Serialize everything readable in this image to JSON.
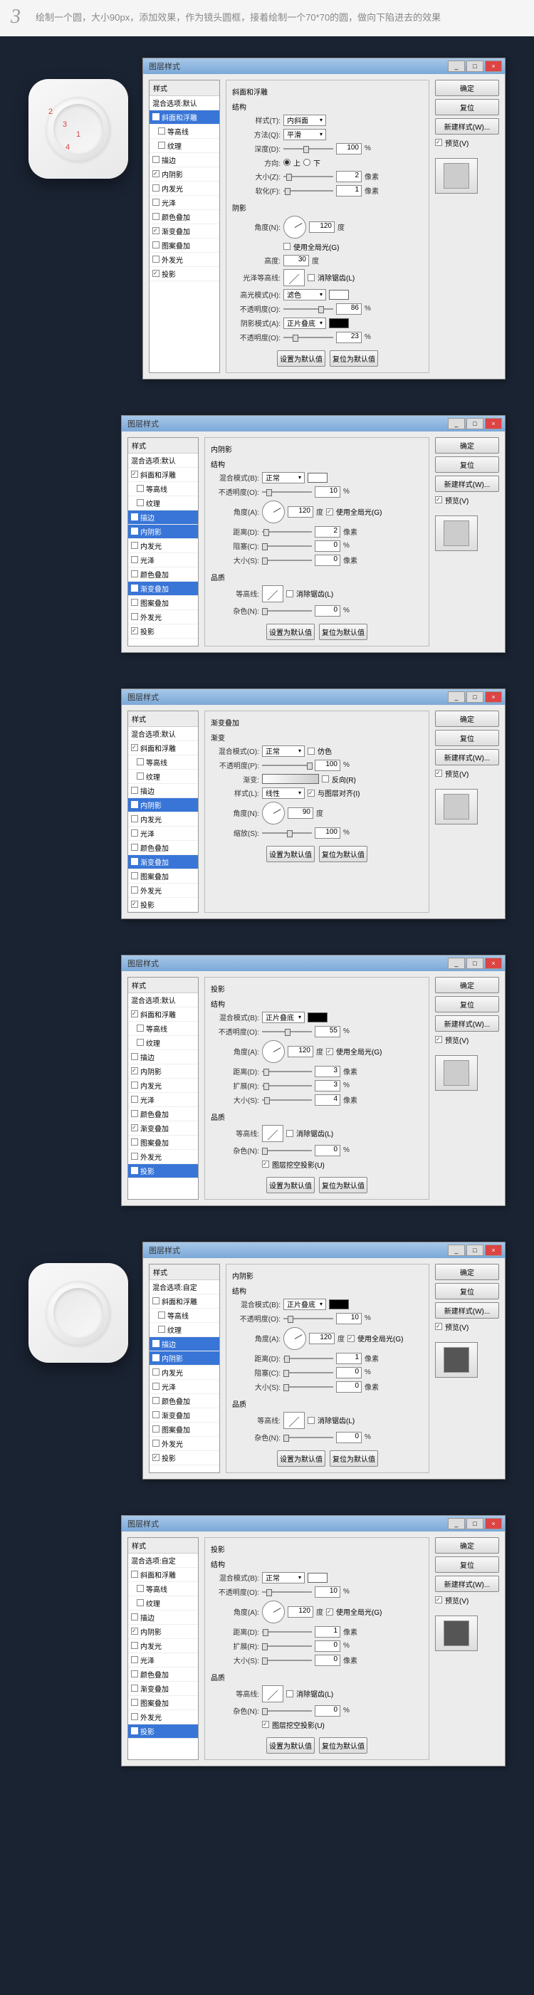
{
  "step_number": "3",
  "header_text": "绘制一个圆，大小90px，添加效果，作为镜头圆框，接着绘制一个70*70的圆，做向下陷进去的效果",
  "dialog_title": "图层样式",
  "styles_header": "样式",
  "blend_header": "混合选项:默认",
  "blend_header_custom": "混合选项:自定",
  "style_items": {
    "bevel": "斜面和浮雕",
    "contour": "等高线",
    "texture": "纹理",
    "stroke": "描边",
    "inner_shadow": "内阴影",
    "inner_glow": "内发光",
    "satin": "光泽",
    "color_overlay": "颜色叠加",
    "gradient_overlay": "渐变叠加",
    "pattern_overlay": "图案叠加",
    "outer_glow": "外发光",
    "drop_shadow": "投影"
  },
  "buttons": {
    "ok": "确定",
    "cancel": "复位",
    "new_style": "新建样式(W)...",
    "preview": "预览(V)",
    "set_default": "设置为默认值",
    "reset_default": "复位为默认值"
  },
  "panel1": {
    "title": "斜面和浮雕",
    "struct": "结构",
    "style_label": "样式(T):",
    "style_val": "内斜面",
    "method_label": "方法(Q):",
    "method_val": "平滑",
    "depth_label": "深度(D):",
    "depth_val": "100",
    "direction_label": "方向:",
    "dir_up": "上",
    "dir_down": "下",
    "size_label": "大小(Z):",
    "size_val": "2",
    "soften_label": "软化(F):",
    "soften_val": "1",
    "shading": "阴影",
    "angle_label": "角度(N):",
    "angle_val": "120",
    "use_global": "使用全局光(G)",
    "altitude_label": "高度:",
    "altitude_val": "30",
    "gloss_label": "光泽等高线:",
    "antialias": "消除锯齿(L)",
    "highlight_mode": "高光模式(H):",
    "highlight_val": "滤色",
    "opacity_label": "不透明度(O):",
    "hl_opacity": "86",
    "shadow_mode": "阴影模式(A):",
    "shadow_val": "正片叠底",
    "sh_opacity": "23",
    "px": "像素",
    "pct": "%",
    "deg": "度"
  },
  "panel2": {
    "title": "内阴影",
    "struct": "结构",
    "blend_label": "混合模式(B):",
    "blend_val": "正常",
    "opacity_label": "不透明度(O):",
    "opacity_val": "10",
    "angle_label": "角度(A):",
    "angle_val": "120",
    "use_global": "使用全局光(G)",
    "distance_label": "距离(D):",
    "distance_val": "2",
    "choke_label": "阻塞(C):",
    "choke_val": "0",
    "size_label": "大小(S):",
    "size_val": "0",
    "quality": "品质",
    "contour_label": "等高线:",
    "antialias": "消除锯齿(L)",
    "noise_label": "杂色(N):",
    "noise_val": "0"
  },
  "panel3": {
    "title": "渐变叠加",
    "gradient_sec": "渐变",
    "blend_label": "混合模式(O):",
    "blend_val": "正常",
    "dither": "仿色",
    "opacity_label": "不透明度(P):",
    "opacity_val": "100",
    "gradient_label": "渐变:",
    "reverse": "反向(R)",
    "style_label": "样式(L):",
    "style_val": "线性",
    "align": "与图层对齐(I)",
    "angle_label": "角度(N):",
    "angle_val": "90",
    "scale_label": "缩放(S):",
    "scale_val": "100"
  },
  "panel4": {
    "title": "投影",
    "struct": "结构",
    "blend_label": "混合模式(B):",
    "blend_val": "正片叠底",
    "opacity_label": "不透明度(O):",
    "opacity_val": "55",
    "angle_label": "角度(A):",
    "angle_val": "120",
    "use_global": "使用全局光(G)",
    "distance_label": "距离(D):",
    "distance_val": "3",
    "spread_label": "扩展(R):",
    "spread_val": "3",
    "size_label": "大小(S):",
    "size_val": "4",
    "quality": "品质",
    "contour_label": "等高线:",
    "antialias": "消除锯齿(L)",
    "noise_label": "杂色(N):",
    "noise_val": "0",
    "knockout": "图层挖空投影(U)"
  },
  "panel5": {
    "title": "内阴影",
    "blend_val": "正片叠底",
    "opacity_val": "10",
    "angle_val": "120",
    "distance_val": "1",
    "choke_val": "0",
    "size_val": "0",
    "noise_val": "0"
  },
  "panel6": {
    "title": "投影",
    "blend_val": "正常",
    "opacity_val": "10",
    "angle_val": "120",
    "distance_val": "1",
    "spread_val": "0",
    "size_val": "0",
    "noise_val": "0"
  }
}
